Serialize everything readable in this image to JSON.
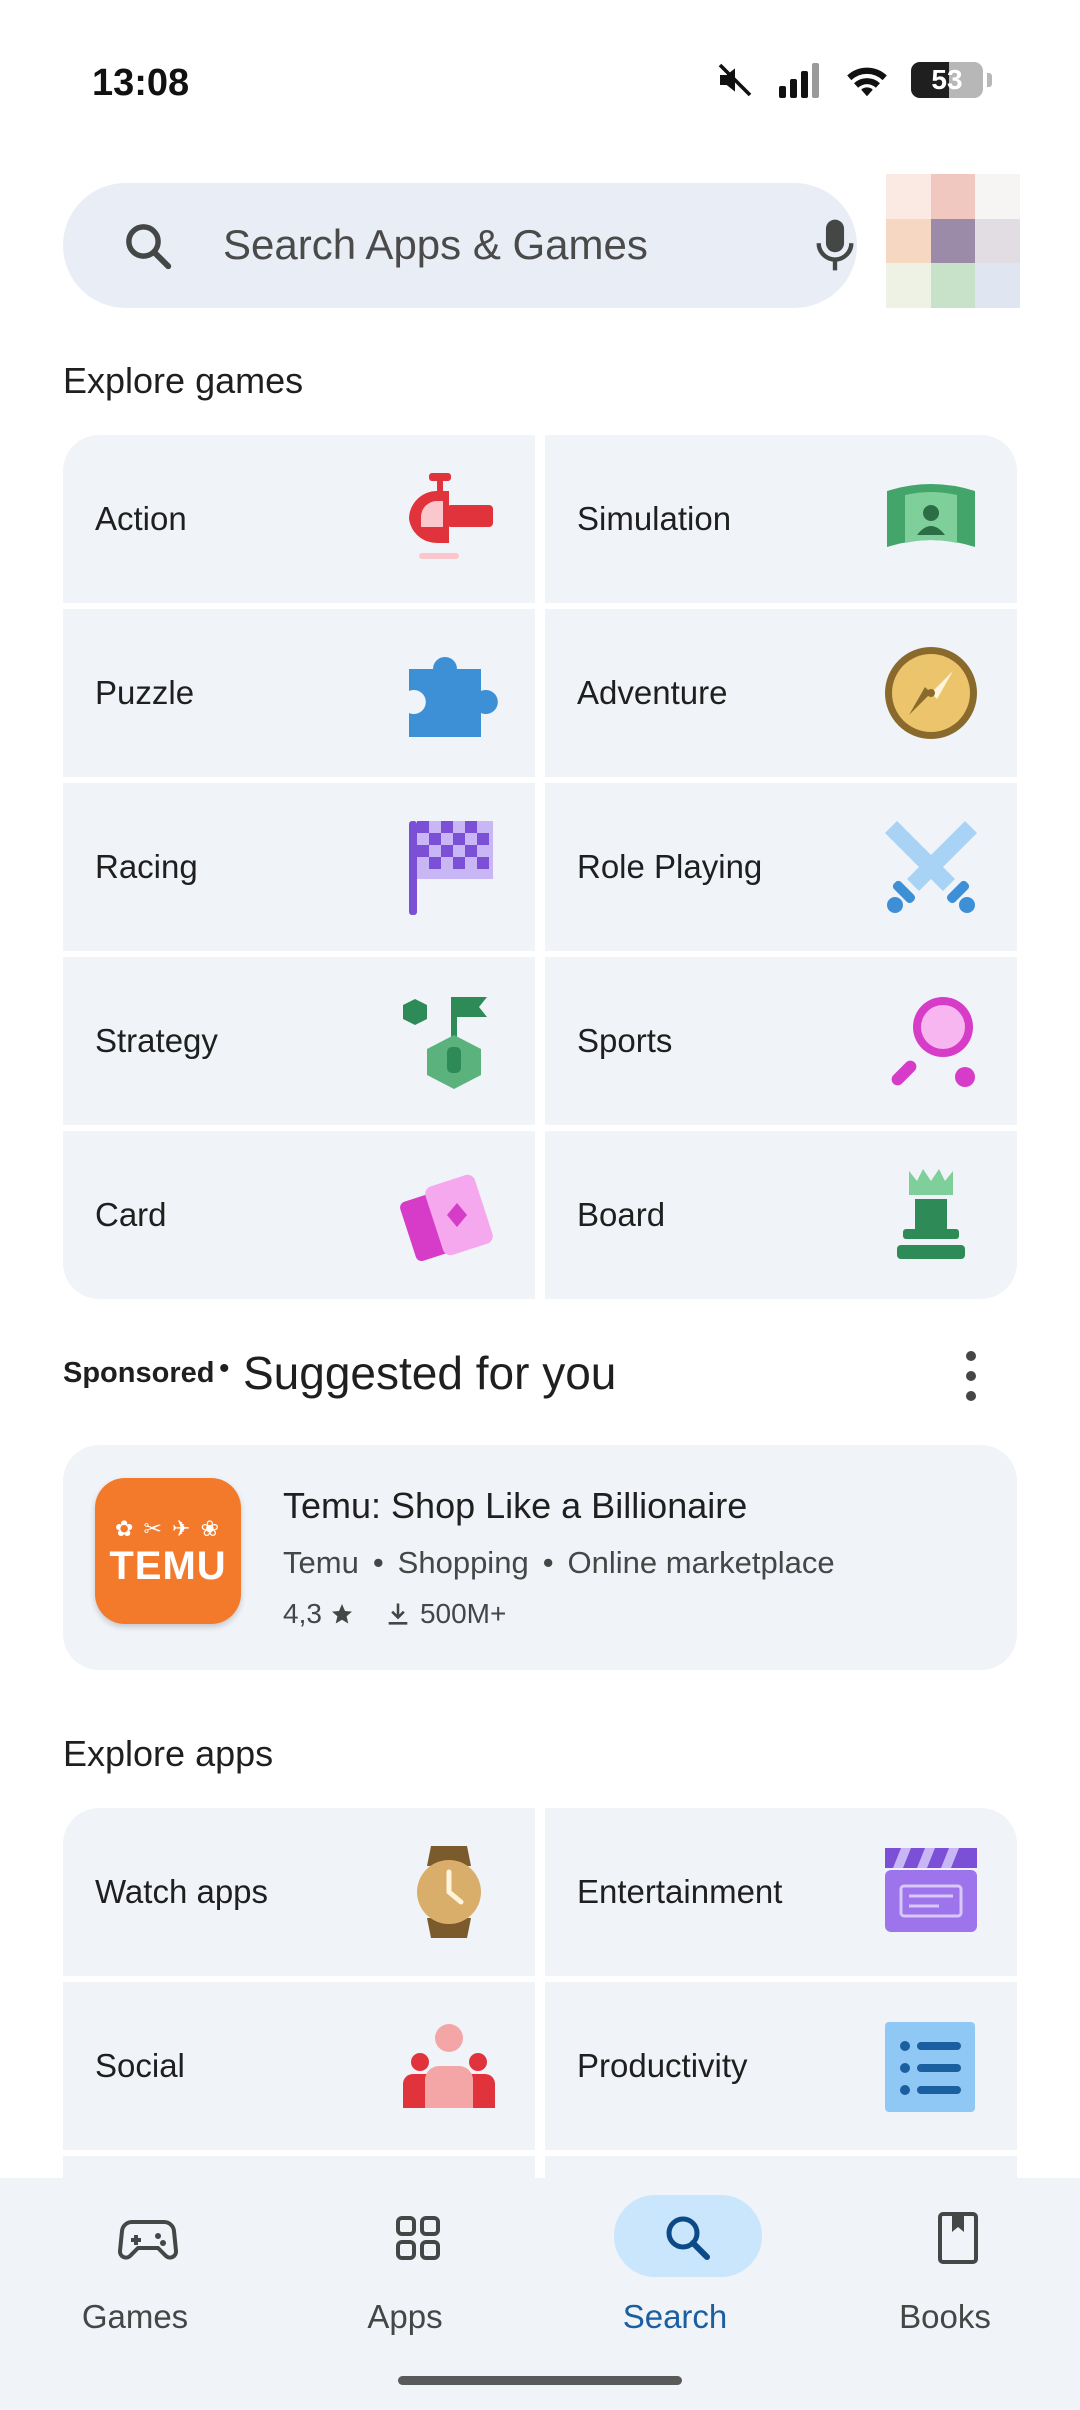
{
  "status_bar": {
    "time": "13:08",
    "battery": "53"
  },
  "search": {
    "placeholder": "Search Apps & Games"
  },
  "explore_games": {
    "title": "Explore games",
    "categories": [
      {
        "label": "Action",
        "icon": "helicopter-icon"
      },
      {
        "label": "Simulation",
        "icon": "vr-screen-icon"
      },
      {
        "label": "Puzzle",
        "icon": "puzzle-piece-icon"
      },
      {
        "label": "Adventure",
        "icon": "compass-icon"
      },
      {
        "label": "Racing",
        "icon": "checkered-flag-icon"
      },
      {
        "label": "Role Playing",
        "icon": "crossed-swords-icon"
      },
      {
        "label": "Strategy",
        "icon": "strategy-flag-icon"
      },
      {
        "label": "Sports",
        "icon": "tennis-racket-icon"
      },
      {
        "label": "Card",
        "icon": "playing-cards-icon"
      },
      {
        "label": "Board",
        "icon": "chess-rook-icon"
      }
    ]
  },
  "suggested": {
    "sponsored_label": "Sponsored",
    "separator": "•",
    "title": "Suggested for you",
    "app": {
      "name": "Temu: Shop Like a Billionaire",
      "developer": "Temu",
      "category": "Shopping",
      "subcategory": "Online marketplace",
      "rating": "4,3",
      "downloads": "500M+",
      "icon_text": "TEMU",
      "icon_color": "#f47a2b"
    }
  },
  "explore_apps": {
    "title": "Explore apps",
    "categories": [
      {
        "label": "Watch apps",
        "icon": "watch-icon"
      },
      {
        "label": "Entertainment",
        "icon": "clapperboard-icon"
      },
      {
        "label": "Social",
        "icon": "people-icon"
      },
      {
        "label": "Productivity",
        "icon": "checklist-icon"
      }
    ]
  },
  "bottom_nav": {
    "items": [
      {
        "label": "Games",
        "icon": "gamepad-icon",
        "active": false
      },
      {
        "label": "Apps",
        "icon": "apps-grid-icon",
        "active": false
      },
      {
        "label": "Search",
        "icon": "search-icon",
        "active": true
      },
      {
        "label": "Books",
        "icon": "book-icon",
        "active": false
      }
    ]
  },
  "colors": {
    "tile_background": "#f0f3f8",
    "search_background": "#e9eef6",
    "active_pill": "#c9e6fd",
    "active_label": "#1a5fa0"
  }
}
